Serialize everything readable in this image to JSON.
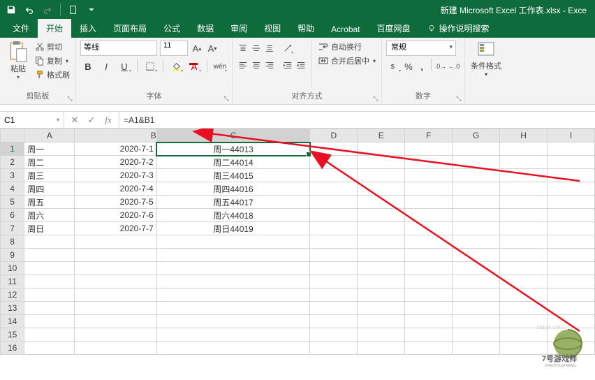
{
  "window": {
    "title": "新建 Microsoft Excel 工作表.xlsx - Exce"
  },
  "tabs": {
    "file": "文件",
    "home": "开始",
    "insert": "插入",
    "layout": "页面布局",
    "formulas": "公式",
    "data": "数据",
    "review": "审阅",
    "view": "视图",
    "help": "帮助",
    "acrobat": "Acrobat",
    "baidu": "百度网盘",
    "tell_me": "操作说明搜索"
  },
  "ribbon": {
    "clipboard": {
      "paste": "粘贴",
      "cut": "剪切",
      "copy": "复制",
      "format_painter": "格式刷",
      "group": "剪贴板"
    },
    "font": {
      "name": "等线",
      "size": "11",
      "group": "字体"
    },
    "align": {
      "wrap": "自动换行",
      "merge": "合并后居中",
      "group": "对齐方式"
    },
    "number": {
      "format": "常规",
      "group": "数字"
    },
    "styles": {
      "cond_fmt": "条件格式"
    }
  },
  "formula_bar": {
    "cell_ref": "C1",
    "formula": "=A1&B1"
  },
  "columns": [
    "A",
    "B",
    "C",
    "D",
    "E",
    "F",
    "G",
    "H",
    "I"
  ],
  "rows": [
    {
      "n": 1,
      "a": "周一",
      "b": "2020-7-1",
      "c": "周一44013"
    },
    {
      "n": 2,
      "a": "周二",
      "b": "2020-7-2",
      "c": "周二44014"
    },
    {
      "n": 3,
      "a": "周三",
      "b": "2020-7-3",
      "c": "周三44015"
    },
    {
      "n": 4,
      "a": "周四",
      "b": "2020-7-4",
      "c": "周四44016"
    },
    {
      "n": 5,
      "a": "周五",
      "b": "2020-7-5",
      "c": "周五44017"
    },
    {
      "n": 6,
      "a": "周六",
      "b": "2020-7-6",
      "c": "周六44018"
    },
    {
      "n": 7,
      "a": "周日",
      "b": "2020-7-7",
      "c": "周日44019"
    }
  ],
  "empty_rows": [
    8,
    9,
    10,
    11,
    12,
    13,
    14,
    15,
    16
  ],
  "selected": {
    "col": "C",
    "row": 1
  },
  "watermark": {
    "site": "7号游戏师",
    "url": "ZHAOYOUXIWANG"
  }
}
